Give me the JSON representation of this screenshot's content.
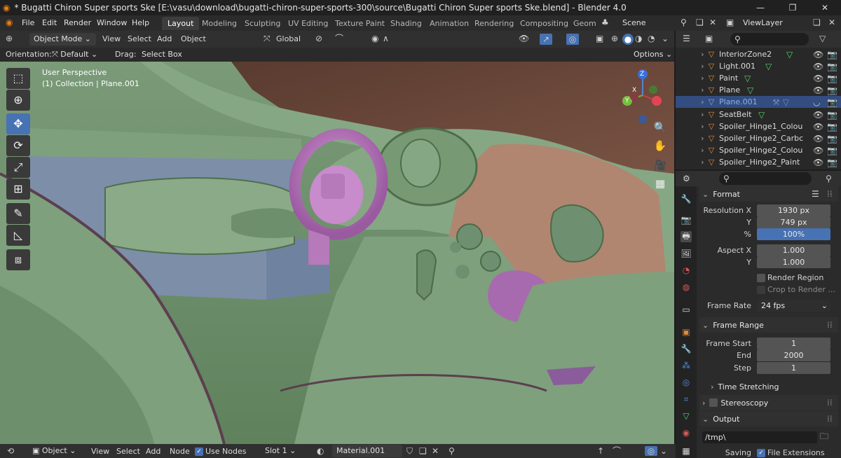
{
  "window": {
    "title": "* Bugatti Chiron Super sports Ske [E:\\vasu\\download\\bugatti-chiron-super-sports-300\\source\\Bugatti Chiron Super sports Ske.blend] - Blender 4.0"
  },
  "menu": [
    "File",
    "Edit",
    "Render",
    "Window",
    "Help"
  ],
  "workspaces": [
    "Layout",
    "Modeling",
    "Sculpting",
    "UV Editing",
    "Texture Paint",
    "Shading",
    "Animation",
    "Rendering",
    "Compositing",
    "Geom"
  ],
  "scene": "Scene",
  "view_layer": "ViewLayer",
  "viewport": {
    "mode": "Object Mode",
    "menus": [
      "View",
      "Select",
      "Add",
      "Object"
    ],
    "transform": "Global",
    "orientation_label": "Orientation:",
    "orientation": "Default",
    "drag_label": "Drag:",
    "drag": "Select Box",
    "options": "Options",
    "overlay_title": "User Perspective",
    "overlay_sub": "(1) Collection | Plane.001",
    "gizmo": {
      "z": "Z",
      "y": "Y",
      "x": "X"
    }
  },
  "outliner": {
    "items": [
      {
        "name": "InteriorZone2",
        "selected": false
      },
      {
        "name": "Light.001",
        "selected": false
      },
      {
        "name": "Paint",
        "selected": false
      },
      {
        "name": "Plane",
        "selected": false
      },
      {
        "name": "Plane.001",
        "selected": true
      },
      {
        "name": "SeatBelt",
        "selected": false
      },
      {
        "name": "Spoiler_Hinge1_Colou",
        "selected": false
      },
      {
        "name": "Spoiler_Hinge2_Carbc",
        "selected": false
      },
      {
        "name": "Spoiler_Hinge2_Colou",
        "selected": false
      },
      {
        "name": "Spoiler_Hinge2_Paint",
        "selected": false
      }
    ]
  },
  "properties": {
    "format": "Format",
    "res_x_label": "Resolution X",
    "res_x": "1930 px",
    "res_y_label": "Y",
    "res_y": "749 px",
    "pct_label": "%",
    "pct": "100%",
    "aspect_x_label": "Aspect X",
    "aspect_x": "1.000",
    "aspect_y_label": "Y",
    "aspect_y": "1.000",
    "render_region": "Render Region",
    "crop": "Crop to Render ...",
    "frame_rate_label": "Frame Rate",
    "frame_rate": "24 fps",
    "frame_range": "Frame Range",
    "start_label": "Frame Start",
    "start": "1",
    "end_label": "End",
    "end": "2000",
    "step_label": "Step",
    "step": "1",
    "time_stretching": "Time Stretching",
    "stereoscopy": "Stereoscopy",
    "output": "Output",
    "path": "/tmp\\",
    "saving_label": "Saving",
    "file_ext": "File Extensions"
  },
  "bottom": {
    "type": "Object",
    "menus": [
      "View",
      "Select",
      "Add",
      "Node"
    ],
    "use_nodes": "Use Nodes",
    "slot": "Slot 1",
    "material": "Material.001"
  },
  "colors": {
    "accent": "#4772b3",
    "viewport_green": "#6b8e6a",
    "interior_brown": "#b08670",
    "purple": "#b073b5",
    "blue_panel": "#7d8ea8"
  }
}
